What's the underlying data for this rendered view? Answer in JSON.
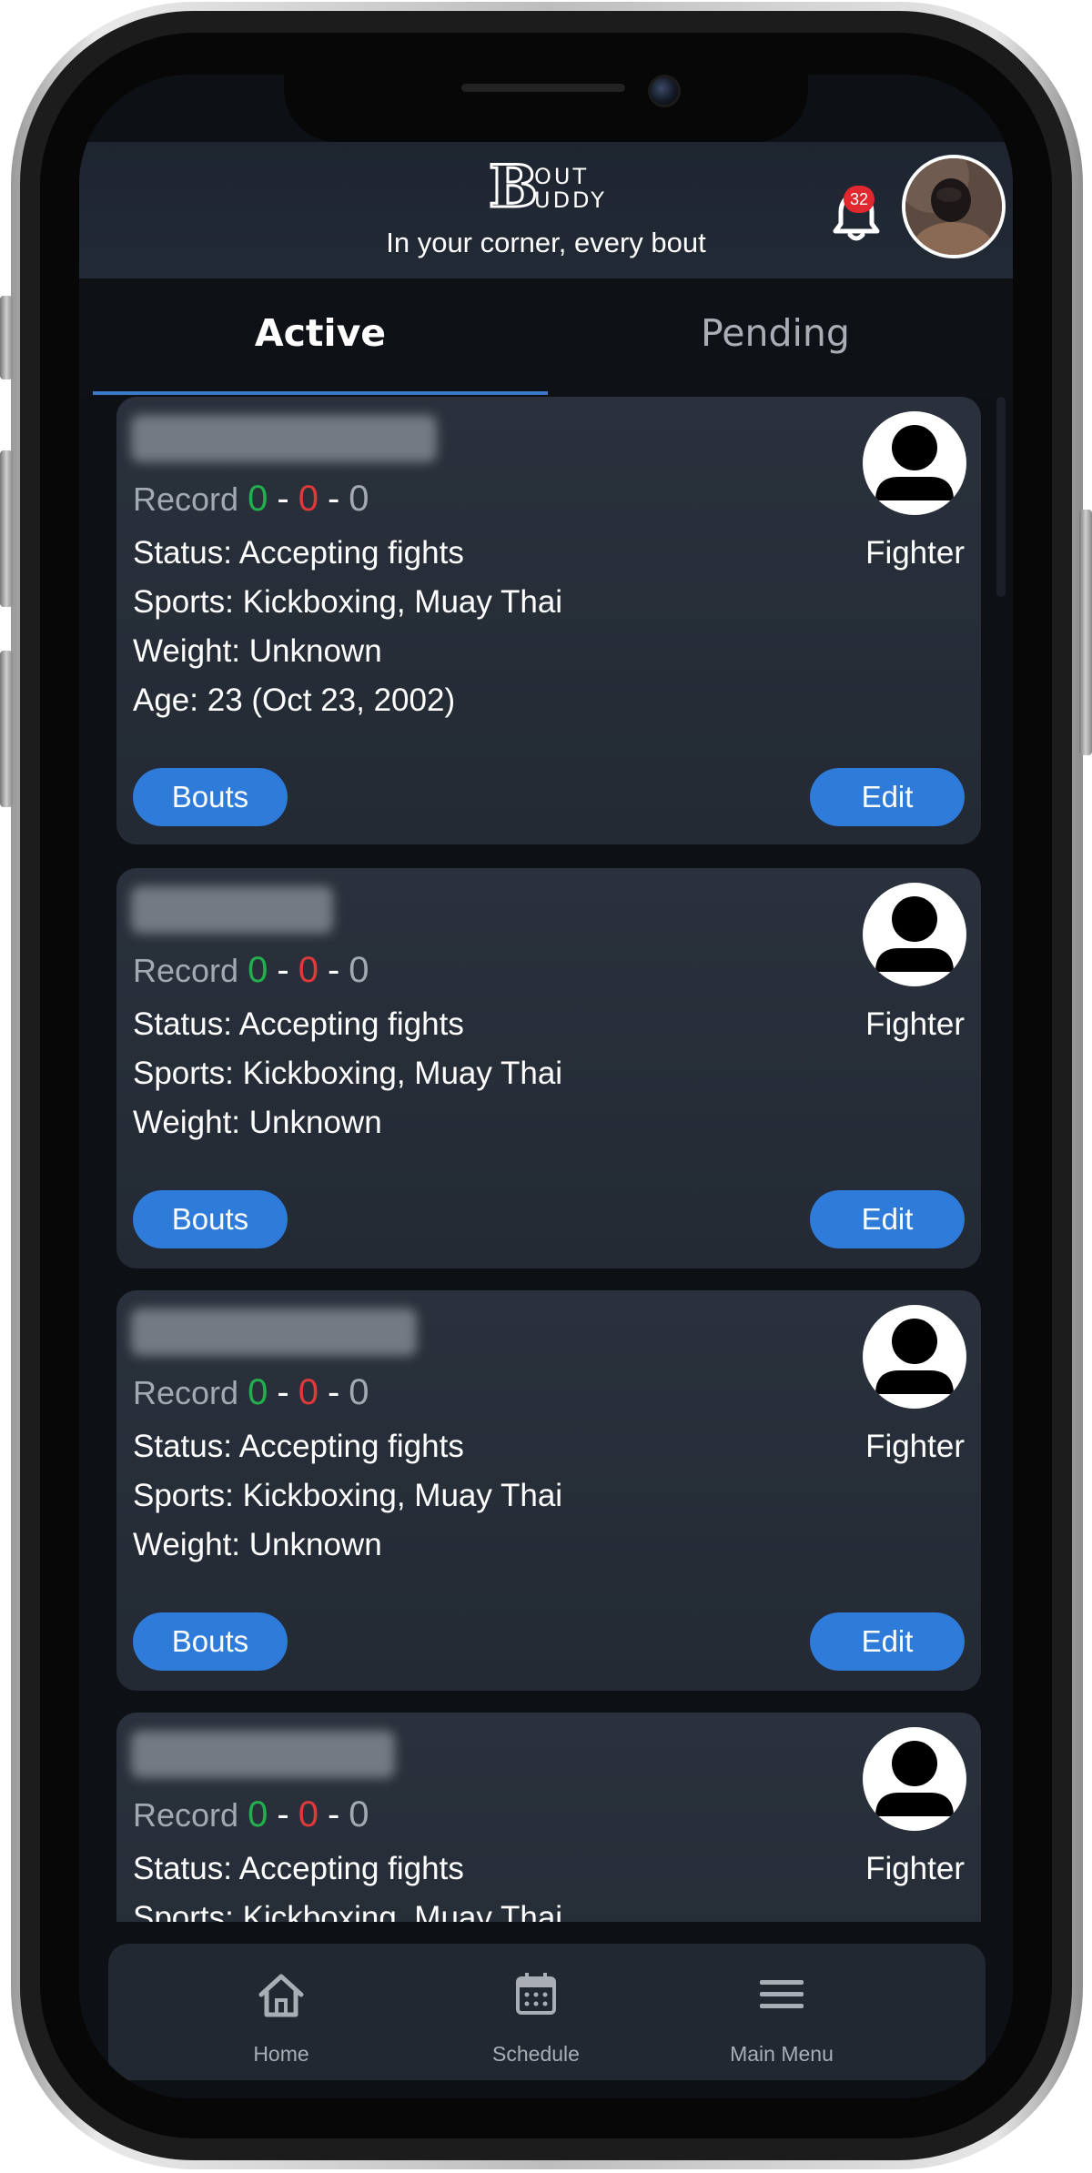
{
  "header": {
    "logo_letter": "B",
    "logo_line1": "OUT",
    "logo_line2": "UDDY",
    "tagline": "In your corner, every bout",
    "notification_count": "32"
  },
  "tabs": [
    {
      "label": "Active",
      "selected": true
    },
    {
      "label": "Pending",
      "selected": false
    }
  ],
  "cards": [
    {
      "record_label": "Record",
      "wins": "0",
      "losses": "0",
      "draws": "0",
      "status": "Status: Accepting fights",
      "sports": "Sports: Kickboxing, Muay Thai",
      "weight": "Weight: Unknown",
      "age": "Age: 23 (Oct 23, 2002)",
      "role": "Fighter",
      "bouts_label": "Bouts",
      "edit_label": "Edit"
    },
    {
      "record_label": "Record",
      "wins": "0",
      "losses": "0",
      "draws": "0",
      "status": "Status: Accepting fights",
      "sports": "Sports: Kickboxing, Muay Thai",
      "weight": "Weight: Unknown",
      "role": "Fighter",
      "bouts_label": "Bouts",
      "edit_label": "Edit"
    },
    {
      "record_label": "Record",
      "wins": "0",
      "losses": "0",
      "draws": "0",
      "status": "Status: Accepting fights",
      "sports": "Sports: Kickboxing, Muay Thai",
      "weight": "Weight: Unknown",
      "role": "Fighter",
      "bouts_label": "Bouts",
      "edit_label": "Edit"
    },
    {
      "record_label": "Record",
      "wins": "0",
      "losses": "0",
      "draws": "0",
      "status": "Status: Accepting fights",
      "sports": "Sports: Kickboxing, Muay Thai",
      "role": "Fighter"
    }
  ],
  "record_separator": "-",
  "bottom_nav": [
    {
      "label": "Home",
      "icon": "home-icon"
    },
    {
      "label": "Schedule",
      "icon": "calendar-icon"
    },
    {
      "label": "Main Menu",
      "icon": "menu-icon"
    }
  ],
  "colors": {
    "accent": "#2e7bd9",
    "win": "#22b04f",
    "loss": "#e0393b",
    "badge": "#e0282e",
    "card": "#262d38",
    "background": "#0d1014"
  }
}
